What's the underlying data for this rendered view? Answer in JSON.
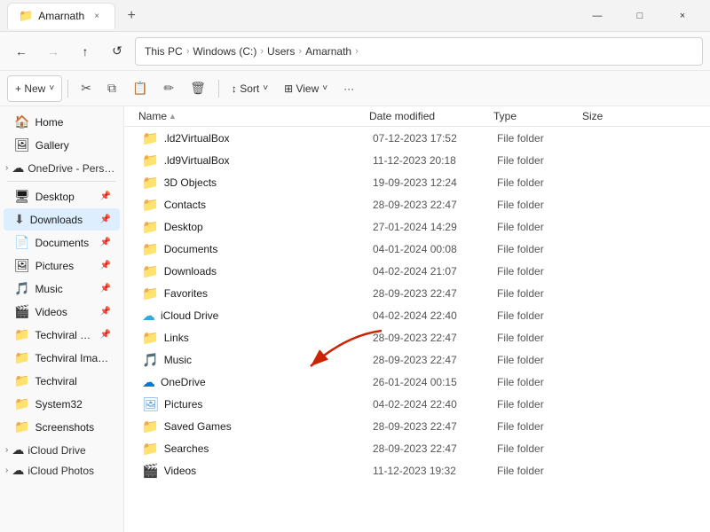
{
  "titlebar": {
    "tab_label": "Amarnath",
    "close_label": "×",
    "new_tab_label": "+",
    "minimize": "—",
    "maximize": "□",
    "close_win": "×"
  },
  "navbar": {
    "back": "←",
    "forward": "→",
    "up": "↑",
    "refresh": "↺",
    "breadcrumbs": [
      "This PC",
      "Windows (C:)",
      "Users",
      "Amarnath"
    ]
  },
  "toolbar": {
    "new_label": "+ New",
    "new_chevron": "˅",
    "cut_icon": "✂",
    "copy_icon": "⧉",
    "paste_icon": "📋",
    "rename_icon": "✏",
    "delete_icon": "🗑",
    "sort_label": "↕ Sort",
    "sort_chevron": "˅",
    "view_label": "⊞ View",
    "view_chevron": "˅",
    "more_label": "···"
  },
  "sidebar": {
    "items": [
      {
        "id": "home",
        "label": "Home",
        "icon": "🏠",
        "pin": false
      },
      {
        "id": "gallery",
        "label": "Gallery",
        "icon": "🖼",
        "pin": false
      },
      {
        "id": "onedrive",
        "label": "OneDrive - Persona",
        "icon": "☁",
        "pin": false,
        "group_chevron": "›"
      },
      {
        "id": "desktop",
        "label": "Desktop",
        "icon": "🖥",
        "pin": true
      },
      {
        "id": "downloads",
        "label": "Downloads",
        "icon": "⬇",
        "pin": true,
        "active": true
      },
      {
        "id": "documents",
        "label": "Documents",
        "icon": "📄",
        "pin": true
      },
      {
        "id": "pictures",
        "label": "Pictures",
        "icon": "🖼",
        "pin": true
      },
      {
        "id": "music",
        "label": "Music",
        "icon": "🎵",
        "pin": true
      },
      {
        "id": "videos",
        "label": "Videos",
        "icon": "🎬",
        "pin": true
      },
      {
        "id": "techviral_docum",
        "label": "Techviral Docum",
        "icon": "📁",
        "pin": true
      },
      {
        "id": "techviral_images",
        "label": "Techviral Images",
        "icon": "📁",
        "pin": false
      },
      {
        "id": "techviral",
        "label": "Techviral",
        "icon": "📁",
        "pin": false
      },
      {
        "id": "system32",
        "label": "System32",
        "icon": "📁",
        "pin": false
      },
      {
        "id": "screenshots",
        "label": "Screenshots",
        "icon": "📁",
        "pin": false
      },
      {
        "id": "icloud_drive",
        "label": "iCloud Drive",
        "icon": "☁",
        "pin": false,
        "group_chevron": "›"
      },
      {
        "id": "icloud_photos",
        "label": "iCloud Photos",
        "icon": "☁",
        "pin": false,
        "group_chevron": "›"
      }
    ]
  },
  "file_list": {
    "columns": [
      "Name",
      "Date modified",
      "Type",
      "Size"
    ],
    "files": [
      {
        "name": ".ld2VirtualBox",
        "date": "07-12-2023 17:52",
        "type": "File folder",
        "size": "",
        "icon": "📁",
        "icon_color": "yellow"
      },
      {
        "name": ".ld9VirtualBox",
        "date": "11-12-2023 20:18",
        "type": "File folder",
        "size": "",
        "icon": "📁",
        "icon_color": "yellow"
      },
      {
        "name": "3D Objects",
        "date": "19-09-2023 12:24",
        "type": "File folder",
        "size": "",
        "icon": "📁",
        "icon_color": "blue"
      },
      {
        "name": "Contacts",
        "date": "28-09-2023 22:47",
        "type": "File folder",
        "size": "",
        "icon": "📁",
        "icon_color": "yellow"
      },
      {
        "name": "Desktop",
        "date": "27-01-2024 14:29",
        "type": "File folder",
        "size": "",
        "icon": "📁",
        "icon_color": "blue"
      },
      {
        "name": "Documents",
        "date": "04-01-2024 00:08",
        "type": "File folder",
        "size": "",
        "icon": "📄",
        "icon_color": "blue"
      },
      {
        "name": "Downloads",
        "date": "04-02-2024 21:07",
        "type": "File folder",
        "size": "",
        "icon": "⬇",
        "icon_color": "blue"
      },
      {
        "name": "Favorites",
        "date": "28-09-2023 22:47",
        "type": "File folder",
        "size": "",
        "icon": "📁",
        "icon_color": "yellow"
      },
      {
        "name": "iCloud Drive",
        "date": "04-02-2024 22:40",
        "type": "File folder",
        "size": "",
        "icon": "☁",
        "icon_color": "icloud",
        "has_arrow": true
      },
      {
        "name": "Links",
        "date": "28-09-2023 22:47",
        "type": "File folder",
        "size": "",
        "icon": "📁",
        "icon_color": "yellow"
      },
      {
        "name": "Music",
        "date": "28-09-2023 22:47",
        "type": "File folder",
        "size": "",
        "icon": "🎵",
        "icon_color": "music"
      },
      {
        "name": "OneDrive",
        "date": "26-01-2024 00:15",
        "type": "File folder",
        "size": "",
        "icon": "☁",
        "icon_color": "onedrive"
      },
      {
        "name": "Pictures",
        "date": "04-02-2024 22:40",
        "type": "File folder",
        "size": "",
        "icon": "🖼",
        "icon_color": "pictures"
      },
      {
        "name": "Saved Games",
        "date": "28-09-2023 22:47",
        "type": "File folder",
        "size": "",
        "icon": "📁",
        "icon_color": "yellow"
      },
      {
        "name": "Searches",
        "date": "28-09-2023 22:47",
        "type": "File folder",
        "size": "",
        "icon": "📁",
        "icon_color": "yellow"
      },
      {
        "name": "Videos",
        "date": "11-12-2023 19:32",
        "type": "File folder",
        "size": "",
        "icon": "🎬",
        "icon_color": "videos"
      }
    ]
  }
}
